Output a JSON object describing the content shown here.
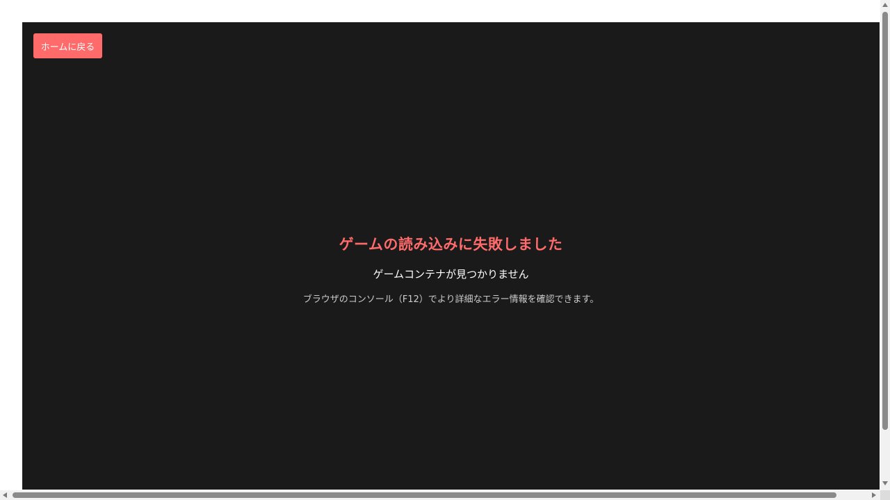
{
  "home_button": {
    "label": "ホームに戻る"
  },
  "error": {
    "title": "ゲームの読み込みに失敗しました",
    "message": "ゲームコンテナが見つかりません",
    "hint": "ブラウザのコンソール（F12）でより詳細なエラー情報を確認できます。"
  },
  "colors": {
    "accent": "#ff6b6b",
    "game_background": "#1a1a1a",
    "page_background": "#ffffff"
  },
  "icons": {
    "scroll_up": "arrow-up-icon",
    "scroll_down": "arrow-down-icon",
    "scroll_left": "arrow-left-icon",
    "scroll_right": "arrow-right-icon"
  }
}
